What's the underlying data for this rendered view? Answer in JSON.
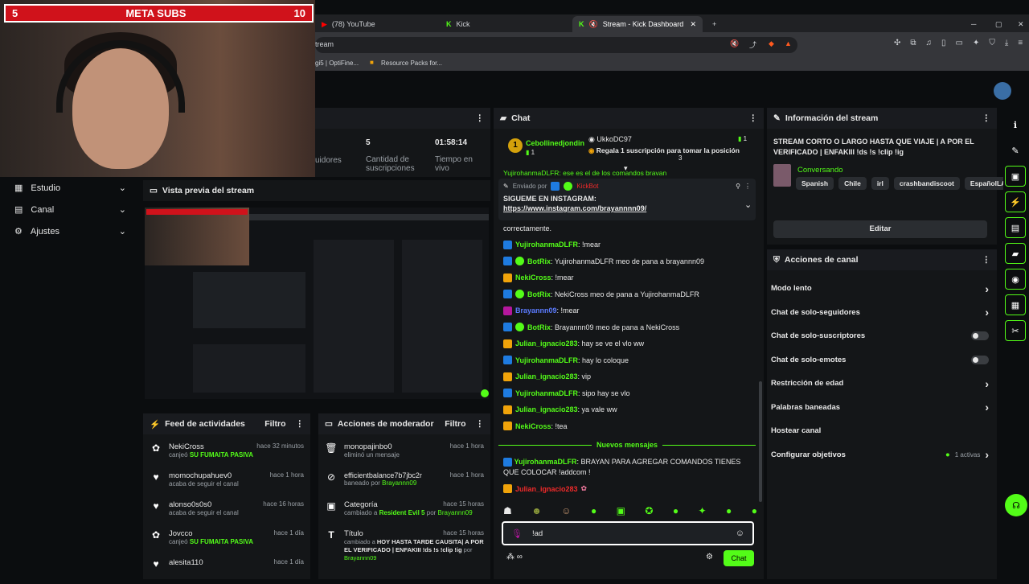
{
  "overlay": {
    "sub_start": "5",
    "sub_title": "META SUBS",
    "sub_goal": "10"
  },
  "browser": {
    "tabs": [
      {
        "label": "(78) YouTube",
        "icon": "youtube-icon"
      },
      {
        "label": "Kick",
        "icon": "kick-icon"
      },
      {
        "label": "Stream - Kick Dashboard",
        "icon": "kick-icon"
      }
    ],
    "url": "tream",
    "bookmarks": [
      "gi5 | OptiFine...",
      "Resource Packs for..."
    ]
  },
  "stats": {
    "partial_label": "uidores",
    "subs_value": "5",
    "subs_label": "Cantidad de suscripciones",
    "time_value": "01:58:14",
    "time_label": "Tiempo en vivo"
  },
  "sidebar": {
    "items": [
      {
        "label": "Estudio",
        "icon": "studio-icon"
      },
      {
        "label": "Canal",
        "icon": "channel-icon"
      },
      {
        "label": "Ajustes",
        "icon": "gear-icon"
      }
    ]
  },
  "preview": {
    "title": "Vista previa del stream"
  },
  "activity": {
    "title": "Feed de actividades",
    "filter": "Filtro",
    "items": [
      {
        "user": "NekiCross",
        "time": "hace 32 minutos",
        "action": "canjeó",
        "reward": "SU FUMAITA PASIVA",
        "icon": "gift-icon"
      },
      {
        "user": "momochupahuev0",
        "time": "hace 1 hora",
        "action": "acaba de seguir el canal",
        "reward": "",
        "icon": "heart-icon"
      },
      {
        "user": "alonso0s0s0",
        "time": "hace 16 horas",
        "action": "acaba de seguir el canal",
        "reward": "",
        "icon": "heart-icon"
      },
      {
        "user": "Jovcco",
        "time": "hace 1 día",
        "action": "canjeó",
        "reward": "SU FUMAITA PASIVA",
        "icon": "gift-icon"
      },
      {
        "user": "alesita110",
        "time": "hace 1 día",
        "action": "",
        "reward": "",
        "icon": "heart-icon"
      }
    ]
  },
  "modactions": {
    "title": "Acciones de moderador",
    "filter": "Filtro",
    "items": [
      {
        "user": "monopajinbo0",
        "time": "hace 1 hora",
        "line": "eliminó un mensaje",
        "icon": "trash-icon"
      },
      {
        "user": "efficientbalance7b7jbc2r",
        "time": "hace 1 hora",
        "line": "baneado por",
        "by": "Brayannn09",
        "icon": "ban-icon"
      },
      {
        "user": "Categoría",
        "time": "hace 15 horas",
        "line": "cambiado a",
        "extra": "Resident Evil 5",
        "by_prefix": "por",
        "by": "Brayannn09",
        "icon": "category-icon"
      },
      {
        "user": "Título",
        "time": "hace 15 horas",
        "line": "cambiado a",
        "extra": "HOY HASTA TARDE CAUSITA| A POR EL VERIFICADO | ENFAKIII !ds !s !clip !ig",
        "by_prefix": "por",
        "by": "Brayannn09",
        "icon": "title-icon"
      }
    ]
  },
  "chat": {
    "title": "Chat",
    "leader": {
      "rank": "1",
      "name": "Cebollinedjondin",
      "count": "1"
    },
    "gift": {
      "user": "UkkoDC97",
      "count": "1",
      "text": "Regala 1 suscripción para tomar la posición",
      "pos": "3"
    },
    "cut_msg": "YujirohanmaDLFR: ese es el de los comandos bravan",
    "pinned": {
      "sender_prefix": "Enviado por",
      "sender": "KickBot",
      "line1": "SIGUEME EN INSTAGRAM:",
      "link": "https://www.instagram.com/brayannnn09/",
      "tail": "correctamente."
    },
    "messages": [
      {
        "user": "YujirohanmaDLFR",
        "text": ": !mear",
        "color": "#53fc18",
        "badge": "#1e7be0"
      },
      {
        "user": "BotRix",
        "text": ": YujirohanmaDLFR meo de pana a brayannn09",
        "color": "#53fc18",
        "badge": "#1e7be0"
      },
      {
        "user": "NekiCross",
        "text": ": !mear",
        "color": "#53fc18",
        "badge": "#f0a30a"
      },
      {
        "user": "BotRix",
        "text": ": NekiCross meo de pana a YujirohanmaDLFR",
        "color": "#53fc18",
        "badge": "#1e7be0"
      },
      {
        "user": "Brayannn09",
        "text": ": !mear",
        "color": "#5b7bff",
        "badge": "#b5179e"
      },
      {
        "user": "BotRix",
        "text": ": Brayannn09 meo de pana a NekiCross",
        "color": "#53fc18",
        "badge": "#1e7be0"
      },
      {
        "user": "Julian_ignacio283",
        "text": ": hay se ve el vlo ww",
        "color": "#53fc18",
        "badge": "#f0a30a"
      },
      {
        "user": "YujirohanmaDLFR",
        "text": ": hay lo coloque",
        "color": "#53fc18",
        "badge": "#1e7be0"
      },
      {
        "user": "Julian_ignacio283",
        "text": ": vip",
        "color": "#53fc18",
        "badge": "#f0a30a"
      },
      {
        "user": "YujirohanmaDLFR",
        "text": ": sipo hay se vlo",
        "color": "#53fc18",
        "badge": "#1e7be0"
      },
      {
        "user": "Julian_ignacio283",
        "text": ": ya vale ww",
        "color": "#53fc18",
        "badge": "#f0a30a"
      },
      {
        "user": "NekiCross",
        "text": ": !tea",
        "color": "#53fc18",
        "badge": "#f0a30a"
      }
    ],
    "new_label": "Nuevos mensajes",
    "new_msg_user": "YujirohanmaDLFR",
    "new_msg_text": ": BRAYAN PARA AGREGAR COMANDOS TIENES QUE COLOCAR !addcom !",
    "last_user": "Julian_ignacio283",
    "input_value": "!ad",
    "send_label": "Chat"
  },
  "info": {
    "title": "Información del stream",
    "stream_title": "STREAM CORTO O LARGO HASTA QUE VIAJE | A POR EL VERIFICADO | ENFAKIII !ds !s !clip !ig",
    "category": "Conversando",
    "tags": [
      "Spanish",
      "Chile",
      "irl",
      "crashbandiscoot",
      "EspañolLATA"
    ],
    "edit_label": "Editar"
  },
  "channel_actions": {
    "title": "Acciones de canal",
    "items": [
      {
        "label": "Modo lento",
        "control": "chevron"
      },
      {
        "label": "Chat de solo-seguidores",
        "control": "chevron"
      },
      {
        "label": "Chat de solo-suscriptores",
        "control": "toggle"
      },
      {
        "label": "Chat de solo-emotes",
        "control": "toggle"
      },
      {
        "label": "Restricción de edad",
        "control": "chevron"
      },
      {
        "label": "Palabras baneadas",
        "control": "chevron"
      },
      {
        "label": "Hostear canal",
        "control": "none"
      },
      {
        "label": "Configurar objetivos",
        "control": "chevron",
        "extra": "1 activas"
      }
    ]
  },
  "colors": {
    "accent": "#53fc18",
    "bg": "#0b0d0f",
    "panel": "#141618",
    "red": "#d0121b"
  }
}
